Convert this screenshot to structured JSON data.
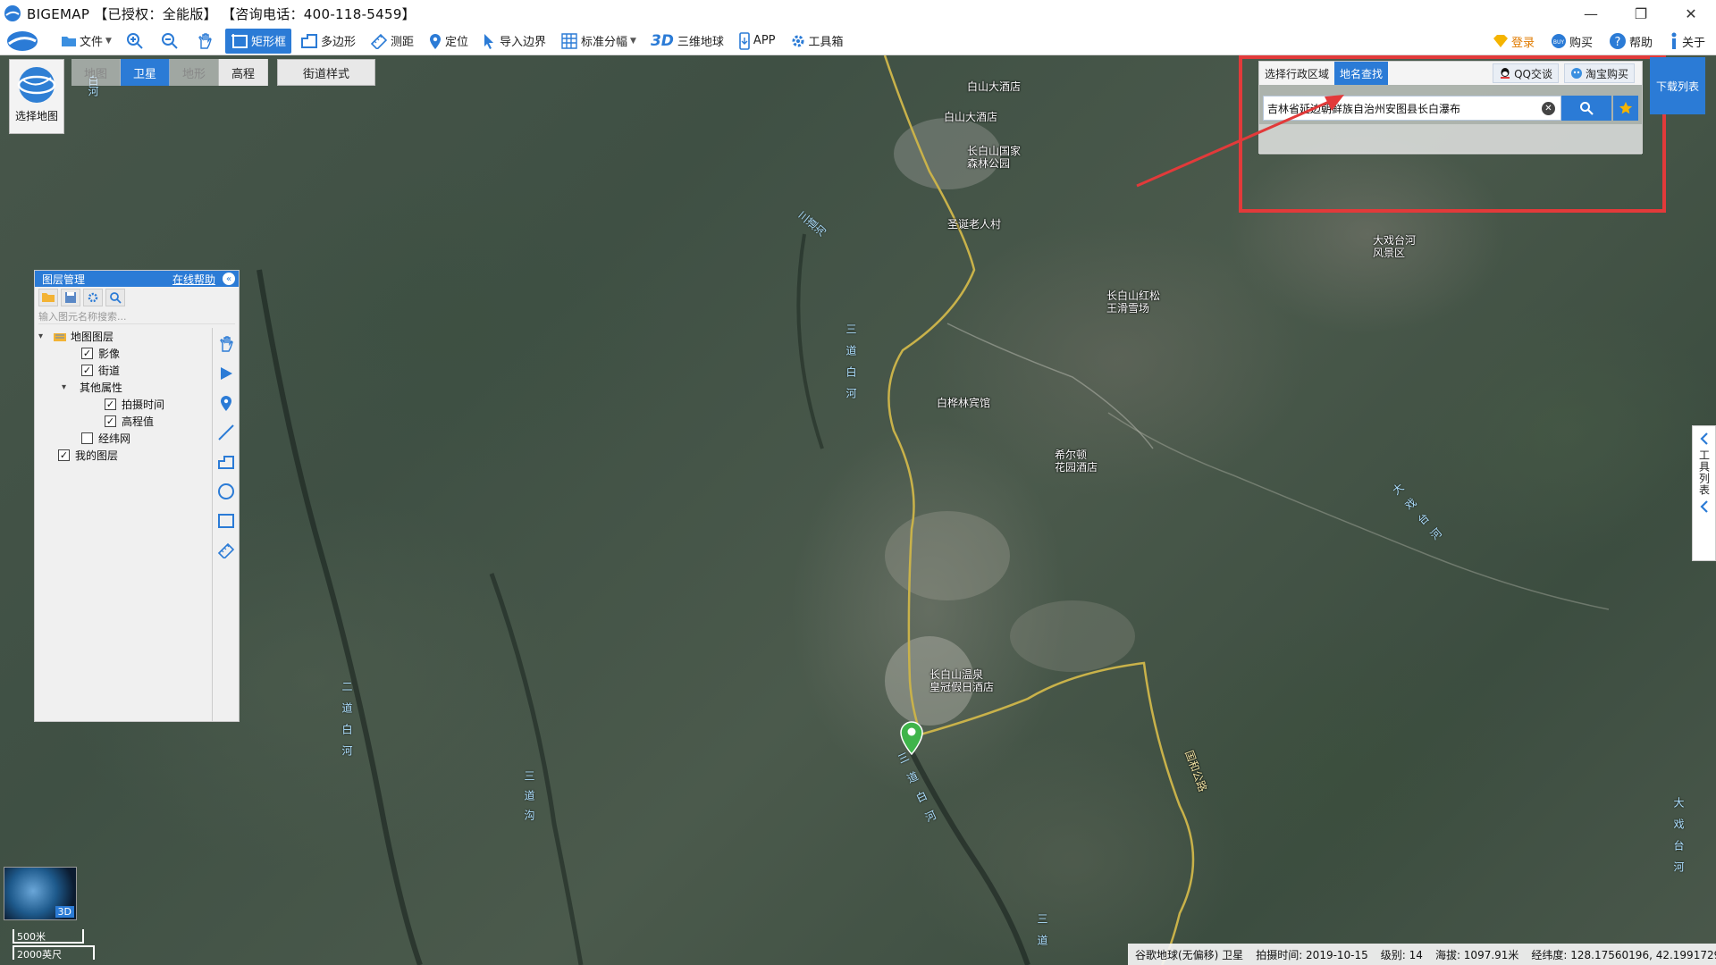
{
  "window": {
    "title": "BIGEMAP 【已授权：全能版】 【咨询电话：400-118-5459】",
    "minimize": "—",
    "restore": "❐",
    "close": "✕"
  },
  "toolbar": {
    "file": "文件",
    "rect": "矩形框",
    "polygon": "多边形",
    "measure": "测距",
    "locate": "定位",
    "import": "导入边界",
    "grid": "标准分幅",
    "threeD_mark": "3D",
    "globe": "三维地球",
    "app": "APP",
    "toolbox": "工具箱",
    "login": "登录",
    "buy": "购买",
    "help": "帮助",
    "about": "关于"
  },
  "maptype": {
    "select_label": "选择地图",
    "tabs": [
      "地图",
      "卫星",
      "地形",
      "高程"
    ],
    "active": "卫星",
    "street_style": "街道样式"
  },
  "search": {
    "tab_region": "选择行政区域",
    "tab_place": "地名查找",
    "qq": "QQ交谈",
    "taobao": "淘宝购买",
    "query": "吉林省延边朝鲜族自治州安图县长白瀑布"
  },
  "download_list": "下载列表",
  "layer_panel": {
    "title": "图层管理",
    "help": "在线帮助",
    "search_placeholder": "输入图元名称搜索...",
    "tree": [
      {
        "label": "地图图层",
        "level": 0,
        "type": "folder"
      },
      {
        "label": "影像",
        "level": 1,
        "checked": true
      },
      {
        "label": "街道",
        "level": 1,
        "checked": true
      },
      {
        "label": "其他属性",
        "level": 1,
        "type": "folder"
      },
      {
        "label": "拍摄时间",
        "level": 2,
        "checked": true
      },
      {
        "label": "高程值",
        "level": 2,
        "checked": true
      },
      {
        "label": "经纬网",
        "level": 1,
        "checked": false
      },
      {
        "label": "我的图层",
        "level": 0,
        "checked": true
      }
    ]
  },
  "tool_list": "工具列表",
  "scale": {
    "metric": "500米",
    "imperial": "2000英尺"
  },
  "minimap_label": "3D",
  "status": {
    "source": "谷歌地球(无偏移) 卫星",
    "shot_time": "拍摄时间: 2019-10-15",
    "level": "级别:  14",
    "altitude": "海拔: 1097.91米",
    "coords": "经纬度:  128.17560196, 42.19917297"
  },
  "map_labels": {
    "poi_1": "白山大酒店",
    "poi_2": "白山大酒店",
    "poi_3": "长白山国家\n森林公园",
    "poi_4": "圣诞老人村",
    "poi_5": "大戏台河\n风景区",
    "poi_6": "长白山红松\n王滑雪场",
    "poi_7": "白桦林宾馆",
    "poi_8": "希尔顿\n花园酒店",
    "poi_9": "长白山温泉\n皇冠假日酒店",
    "road": "国和公路",
    "river_1": "白河",
    "river_2": "三道沟",
    "river_3": "三道白河",
    "river_4": "二道白河",
    "river_5": "三道沟",
    "river_6": "三道白河",
    "river_7": "大戏台河",
    "river_8": "大戏台河",
    "river_9": "三道"
  }
}
